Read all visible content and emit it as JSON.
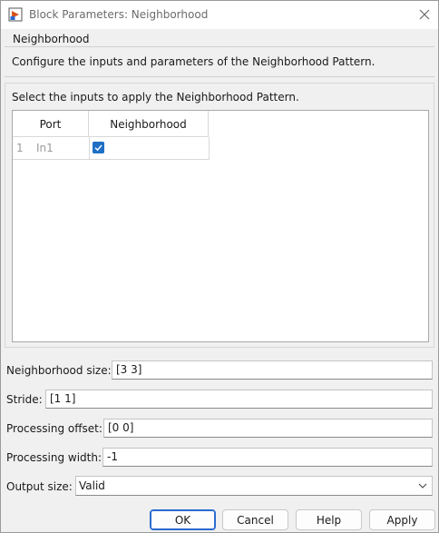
{
  "window": {
    "title": "Block Parameters: Neighborhood"
  },
  "section": {
    "title": "Neighborhood",
    "description": "Configure the inputs and parameters of the Neighborhood Pattern."
  },
  "inputs": {
    "label": "Select the inputs to apply the Neighborhood Pattern.",
    "columns": [
      "Port",
      "Neighborhood"
    ],
    "rows": [
      {
        "index": "1",
        "port": "In1",
        "neighborhood_checked": true
      }
    ]
  },
  "params": {
    "neighborhood_size": {
      "label": "Neighborhood size:",
      "value": "[3 3]"
    },
    "stride": {
      "label": "Stride:",
      "value": "[1 1]"
    },
    "processing_offset": {
      "label": "Processing offset:",
      "value": "[0 0]"
    },
    "processing_width": {
      "label": "Processing width:",
      "value": "-1"
    },
    "output_size": {
      "label": "Output size:",
      "value": "Valid"
    }
  },
  "buttons": {
    "ok": "OK",
    "cancel": "Cancel",
    "help": "Help",
    "apply": "Apply"
  },
  "icons": {
    "app": "simulink-block-icon",
    "close": "close-icon",
    "check": "check-icon",
    "chevron": "chevron-down-icon"
  },
  "colors": {
    "accent": "#1f6fc5",
    "primary_button_border": "#2a6ad0"
  }
}
